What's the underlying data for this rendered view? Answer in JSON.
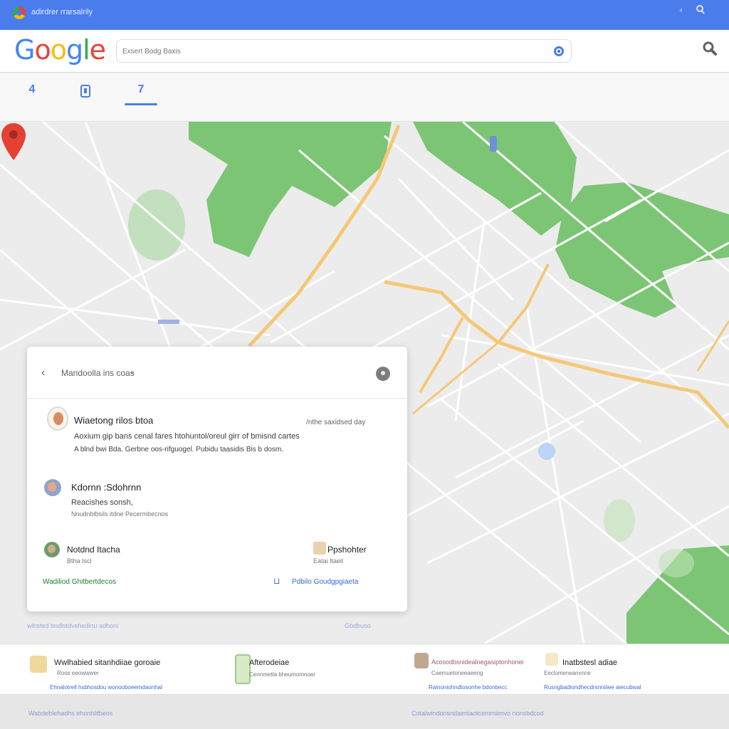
{
  "window": {
    "title": "adirdrer rrarsalrily"
  },
  "header": {
    "logo": "Google",
    "search_placeholder": "Exsert Bodg Baxis"
  },
  "tabs": [
    {
      "label": "4"
    },
    {
      "label": "0"
    },
    {
      "label": "7"
    }
  ],
  "card": {
    "title": "Mandoolla ins coas",
    "reviews": [
      {
        "name": "Wiaetong rilos btoa",
        "time": "/nthe saxidsed day",
        "line1": "Aoxium gip bans cenal fares htohuntol/oreul girr of bmisnd cartes",
        "line2": "A blnd bwi Bda. Gerbne oos-rifguogel. Pubidu taasidis Bis b dosm."
      },
      {
        "name": "Kdornn :Sdohrnn",
        "line1": "Reacishes sonsh,",
        "line2": "Nnudnblbsils itdne Pecermbecnos"
      },
      {
        "name": "Notdnd Itacha",
        "sub": "Btha Iscl",
        "right_name": "Ppshohter",
        "right_sub": "Eatai Itaeil"
      }
    ],
    "green_link": "Wadiliod Ghitbertdecos",
    "blue_link": "Pdbilo Goudgpgiaeta",
    "shadow_text": "wibsted bndlstdvehedinu adhoni"
  },
  "map_text": "Gbdbuso",
  "results": [
    {
      "title": "Wwlhabied sitanhdiiae goroaie",
      "sub": "Roos eeowwwer",
      "link": "Ehnalotrell hsbhosdou wonooboeemdaonhal"
    },
    {
      "title": "Afterodeiae",
      "sub": "Cennmetta bheumomnoer",
      "link": ""
    },
    {
      "title": "Acosodbsnidealnegasiptonhonei",
      "sub": "Caemuetoneeaeeng",
      "link": "Rainoniohndtosonhe bdonbecc"
    },
    {
      "title": "Inatbstesl adiae",
      "sub": "Eeclomerwanvnne",
      "link": "Rusngbadiondhecdrsnniiiee aiecubwal"
    }
  ],
  "footer": {
    "left": "Wabdeblehadhs ehonhlitbeos",
    "right": "Cotalwindonsndaeriiaotcemmiimvo nonsbdcod"
  },
  "colors": {
    "title_bar": "#4a7cec",
    "park_green": "#7cc574",
    "road_orange": "#f5c877",
    "pin_red": "#e44134"
  }
}
